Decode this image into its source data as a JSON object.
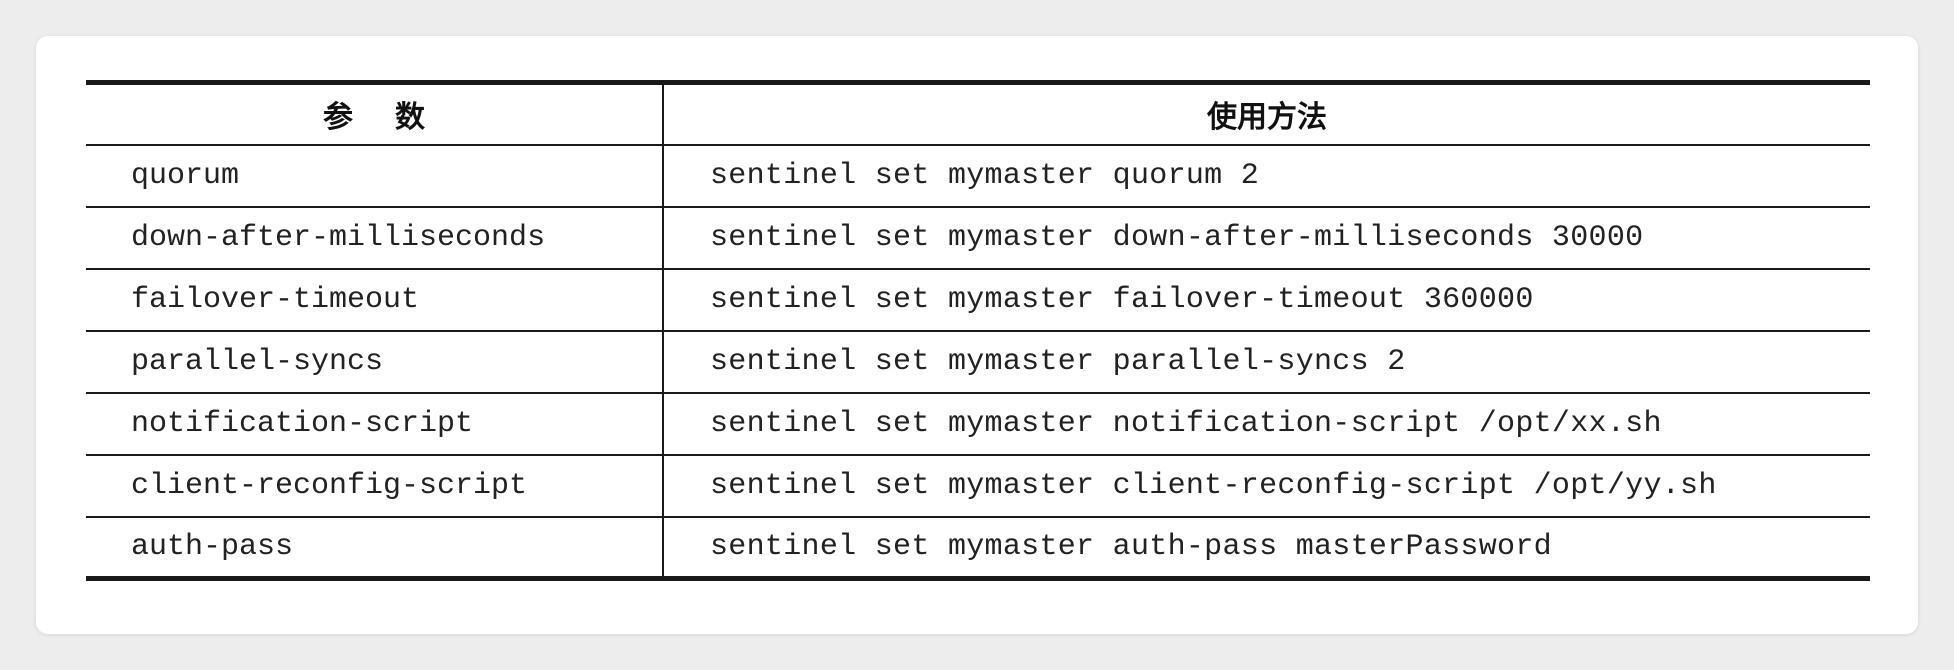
{
  "table": {
    "headers": {
      "param": "参数",
      "usage": "使用方法"
    },
    "rows": [
      {
        "param": "quorum",
        "usage": "sentinel set mymaster quorum 2"
      },
      {
        "param": "down-after-milliseconds",
        "usage": "sentinel set mymaster down-after-milliseconds 30000"
      },
      {
        "param": "failover-timeout",
        "usage": "sentinel set mymaster failover-timeout 360000"
      },
      {
        "param": "parallel-syncs",
        "usage": "sentinel set mymaster parallel-syncs 2"
      },
      {
        "param": "notification-script",
        "usage": "sentinel set mymaster notification-script /opt/xx.sh"
      },
      {
        "param": "client-reconfig-script",
        "usage": "sentinel set mymaster client-reconfig-script /opt/yy.sh"
      },
      {
        "param": "auth-pass",
        "usage": "sentinel set mymaster auth-pass masterPassword"
      }
    ]
  }
}
